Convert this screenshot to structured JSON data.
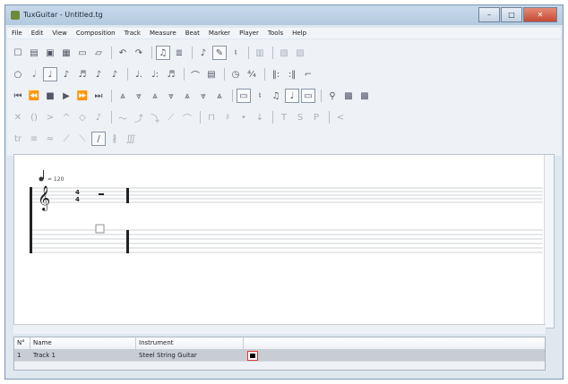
{
  "window": {
    "title": "TuxGuitar - Untitled.tg",
    "min_symbol": "–",
    "max_symbol": "□",
    "close_symbol": "✕"
  },
  "menu": [
    "File",
    "Edit",
    "View",
    "Composition",
    "Track",
    "Measure",
    "Beat",
    "Marker",
    "Player",
    "Tools",
    "Help"
  ],
  "score": {
    "tempo_text": "= 120",
    "time_sig_top": "4",
    "time_sig_bottom": "4"
  },
  "tracks": {
    "headers": {
      "number": "N°",
      "name": "Name",
      "instrument": "Instrument"
    },
    "rows": [
      {
        "number": "1",
        "name": "Track 1",
        "instrument": "Steel String Guitar",
        "color": "#000000"
      }
    ]
  },
  "colors": {
    "accent": "#e0563c",
    "window_border": "#7e95b0"
  },
  "icons": {
    "app": "tuxguitar-logo-icon",
    "toolbar_row1": [
      "new-icon",
      "open-icon",
      "save-icon",
      "save-as-icon",
      "print-icon",
      "print-preview-icon",
      "undo-icon",
      "redo-icon",
      "score-view-icon",
      "tab-view-icon",
      "edit-mode-icon",
      "pencil-icon",
      "transpose-icon",
      "layout-icon",
      "ruler-icon",
      "fretboard-icon"
    ],
    "toolbar_row2": [
      "whole-note-icon",
      "half-note-icon",
      "quarter-note-icon",
      "eighth-note-icon",
      "sixteenth-note-icon",
      "thirtysecond-note-icon",
      "sixtyfourth-note-icon",
      "dotted-icon",
      "double-dotted-icon",
      "tuplet-icon",
      "tie-icon",
      "dynamic-icon",
      "tempo-icon",
      "time-signature-icon",
      "repeat-open-icon",
      "repeat-close-icon",
      "alternate-ending-icon"
    ],
    "toolbar_row3": [
      "first-icon",
      "prev-icon",
      "stop-icon",
      "play-icon",
      "next-icon",
      "last-icon",
      "fade-icon",
      "pp-icon",
      "p-icon",
      "mp-icon",
      "mf-icon",
      "f-icon",
      "ff-icon",
      "transport-icon",
      "chord-icon",
      "metronome-icon",
      "mixer-icon",
      "tuner-icon"
    ],
    "toolbar_row4": [
      "dead-note-icon",
      "ghost-note-icon",
      "accent-icon",
      "heavy-accent-icon",
      "harmonic-icon",
      "grace-icon",
      "vibrato-icon",
      "bend-icon",
      "tremolo-bar-icon",
      "slide-icon",
      "hammer-icon",
      "let-ring-icon",
      "palm-mute-icon",
      "staccato-icon",
      "tapping-icon",
      "slapping-icon",
      "popping-icon",
      "fade-in-icon"
    ],
    "toolbar_row5": [
      "trill-icon",
      "tremolo-picking-icon",
      "tremolo-icon",
      "slide-up-icon",
      "slide-down-icon",
      "legato-icon",
      "fingering-icon",
      "tenuto-icon"
    ]
  }
}
